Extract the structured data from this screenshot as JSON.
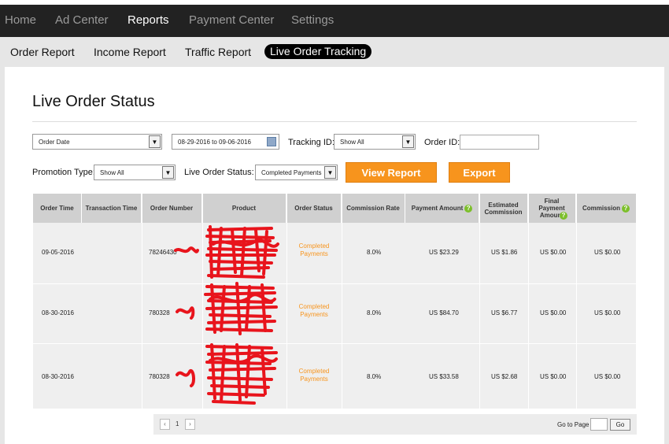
{
  "topnav": {
    "items": [
      {
        "label": "Home",
        "active": false
      },
      {
        "label": "Ad Center",
        "active": false
      },
      {
        "label": "Reports",
        "active": true
      },
      {
        "label": "Payment Center",
        "active": false
      },
      {
        "label": "Settings",
        "active": false
      }
    ]
  },
  "subnav": {
    "items": [
      {
        "label": "Order Report",
        "active": false
      },
      {
        "label": "Income Report",
        "active": false
      },
      {
        "label": "Traffic Report",
        "active": false
      },
      {
        "label": "Live Order Tracking",
        "active": true
      }
    ]
  },
  "page": {
    "title": "Live Order Status"
  },
  "filters": {
    "order_date_select": "Order Date",
    "date_range": "08-29-2016 to 09-06-2016",
    "tracking_id_label": "Tracking ID:",
    "tracking_id_select": "Show All",
    "order_id_label": "Order ID:",
    "order_id_value": "",
    "promotion_type_label": "Promotion Type:",
    "promotion_type_select": "Show All",
    "live_order_status_label": "Live Order Status:",
    "live_order_status_select": "Completed Payments",
    "view_report_label": "View Report",
    "export_label": "Export"
  },
  "table": {
    "headers": [
      "Order Time",
      "Transaction Time",
      "Order Number",
      "Product",
      "Order Status",
      "Commission Rate",
      "Payment Amount",
      "Estimated Commission",
      "Final Payment Amount",
      "Commission"
    ],
    "rows": [
      {
        "order_time": "09-05-2016",
        "transaction_time": "",
        "order_number": "78246430",
        "product": "",
        "status_line1": "Completed",
        "status_line2": "Payments",
        "rate": "8.0%",
        "payment": "US $23.29",
        "est_commission": "US $1.86",
        "final_payment": "US $0.00",
        "commission": "US $0.00"
      },
      {
        "order_time": "08-30-2016",
        "transaction_time": "",
        "order_number": "780328",
        "product": "",
        "status_line1": "Completed",
        "status_line2": "Payments",
        "rate": "8.0%",
        "payment": "US $84.70",
        "est_commission": "US $6.77",
        "final_payment": "US $0.00",
        "commission": "US $0.00"
      },
      {
        "order_time": "08-30-2016",
        "transaction_time": "",
        "order_number": "780328",
        "product": "",
        "status_line1": "Completed",
        "status_line2": "Payments",
        "rate": "8.0%",
        "payment": "US $33.58",
        "est_commission": "US $2.68",
        "final_payment": "US $0.00",
        "commission": "US $0.00"
      }
    ]
  },
  "pager": {
    "prev": "‹",
    "page": "1",
    "next": "›",
    "goto_label": "Go to Page",
    "go_label": "Go"
  },
  "colors": {
    "accent": "#f7941d",
    "nav_bg": "#222222",
    "help_icon": "#7cbf2a",
    "redaction": "#e8141c"
  }
}
